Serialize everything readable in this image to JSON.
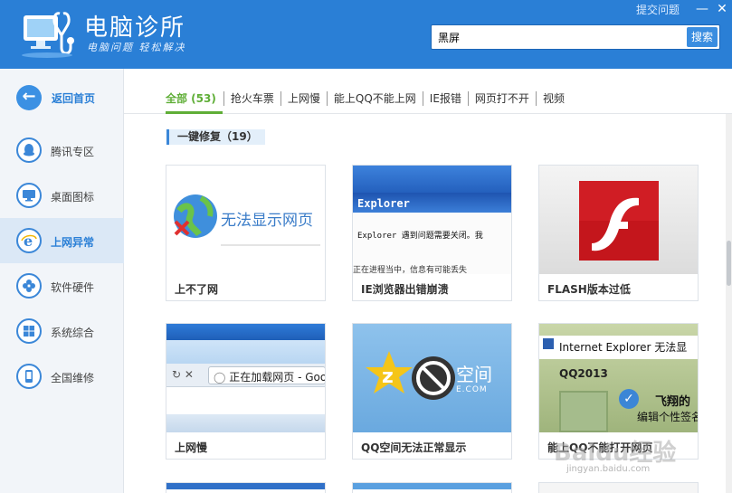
{
  "header": {
    "title": "电脑诊所",
    "subtitle": "电脑问题 轻松解决",
    "feedback": "提交问题",
    "minimize": "—",
    "close": "✕",
    "search_value": "黑屏",
    "search_button": "搜索",
    "brand_color": "#2a7fd6"
  },
  "sidebar": {
    "back_label": "返回首页",
    "items": [
      {
        "label": "腾讯专区",
        "icon": "qq-penguin-icon"
      },
      {
        "label": "桌面图标",
        "icon": "monitor-icon"
      },
      {
        "label": "上网异常",
        "icon": "ie-icon",
        "active": true
      },
      {
        "label": "软件硬件",
        "icon": "fan-icon"
      },
      {
        "label": "系统综合",
        "icon": "windows-icon"
      },
      {
        "label": "全国维修",
        "icon": "phone-icon"
      }
    ]
  },
  "tabs": [
    "全部 (53)",
    "抢火车票",
    "上网慢",
    "能上QQ不能上网",
    "IE报错",
    "网页打不开",
    "视频"
  ],
  "section": {
    "title": "一键修复（19）"
  },
  "cards": [
    {
      "title": "上不了网",
      "thumb_text": "无法显示网页"
    },
    {
      "title": "IE浏览器出错崩溃",
      "thumb_title": "Explorer",
      "thumb_text": "Explorer 遇到问题需要关闭。我",
      "thumb_text2": "正在进程当中，信息有可能丢失"
    },
    {
      "title": "FLASH版本过低"
    },
    {
      "title": "上网慢",
      "thumb_text": "正在加载网页 - Goo"
    },
    {
      "title": "QQ空间无法正常显示",
      "thumb_text": "空间",
      "thumb_text2": "E.COM"
    },
    {
      "title": "能上QQ不能打开网页",
      "thumb_text": "Internet Explorer 无法显",
      "thumb_text2": "QQ2013",
      "thumb_text3": "飞翔的",
      "thumb_text4": "编辑个性签名"
    }
  ],
  "watermark": {
    "main": "Baidu经验",
    "sub": "jingyan.baidu.com"
  }
}
